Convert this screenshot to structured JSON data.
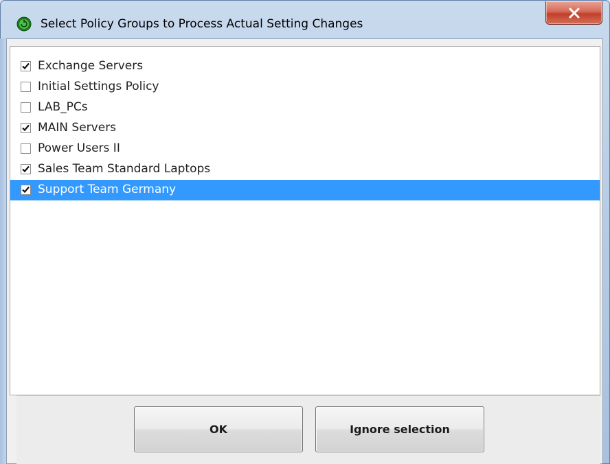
{
  "window": {
    "title": "Select Policy Groups to Process Actual Setting Changes",
    "app_icon": "green-circle-app-icon",
    "close_icon": "close-icon"
  },
  "list": {
    "items": [
      {
        "label": "Exchange Servers",
        "checked": true,
        "selected": false
      },
      {
        "label": "Initial Settings Policy",
        "checked": false,
        "selected": false
      },
      {
        "label": "LAB_PCs",
        "checked": false,
        "selected": false
      },
      {
        "label": "MAIN Servers",
        "checked": true,
        "selected": false
      },
      {
        "label": "Power Users II",
        "checked": false,
        "selected": false
      },
      {
        "label": "Sales Team Standard Laptops",
        "checked": true,
        "selected": false
      },
      {
        "label": "Support Team Germany",
        "checked": true,
        "selected": true
      }
    ],
    "selection_color": "#3399ff"
  },
  "buttons": {
    "ok_label": "OK",
    "ignore_label": "Ignore selection"
  }
}
